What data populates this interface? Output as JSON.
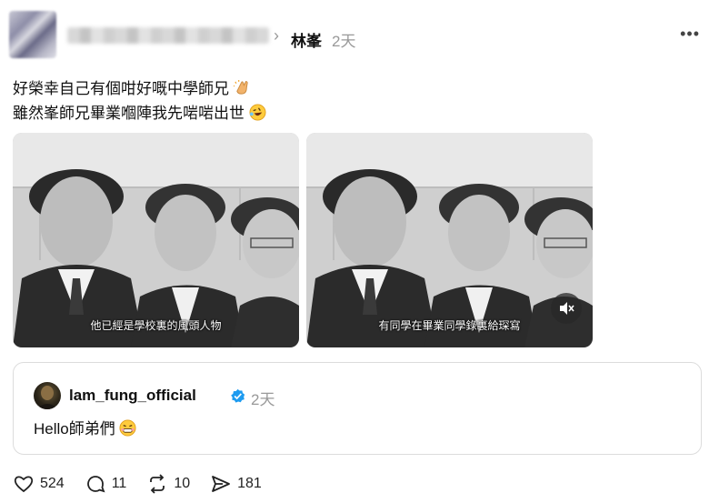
{
  "post": {
    "cross_post_user": "林峯",
    "time": "2天",
    "more": "•••",
    "text_line1": "好榮幸自己有個咁好嘅中學師兄",
    "text_line2": "雖然峯師兄畢業嗰陣我先啱啱出世"
  },
  "media": [
    {
      "caption": "他已經是學校裏的風頭人物"
    },
    {
      "caption": "有同學在畢業同學錄裏給琛寫"
    }
  ],
  "quoted_post": {
    "username": "lam_fung_official",
    "time": "2天",
    "text": "Hello師弟們"
  },
  "actions": {
    "likes": "524",
    "replies": "11",
    "reposts": "10",
    "shares": "181"
  },
  "colors": {
    "verified": "#1d9bf0",
    "meta_gray": "#999999",
    "text": "#111111"
  }
}
